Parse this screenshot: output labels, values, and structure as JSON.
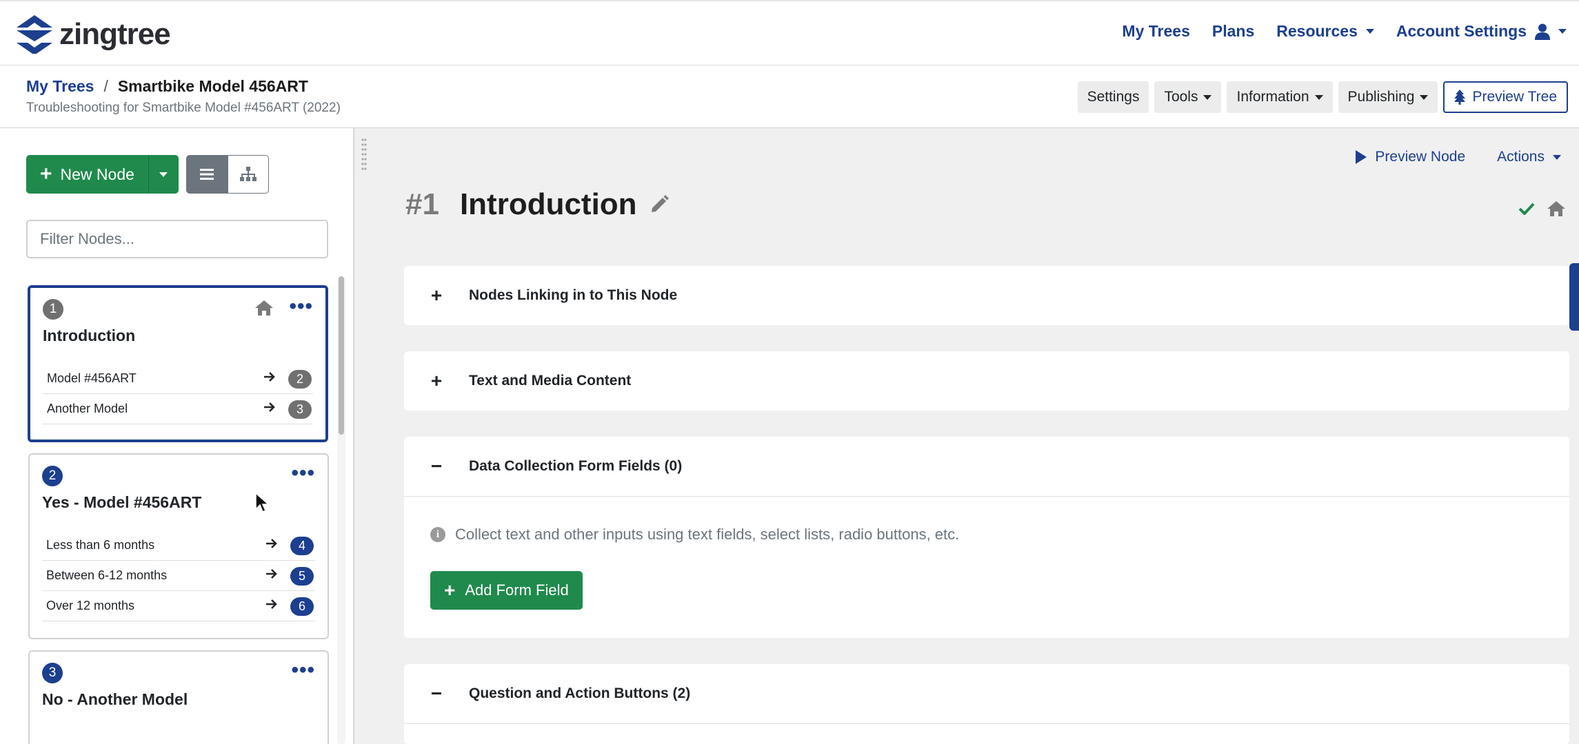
{
  "brand": {
    "name": "zingtree",
    "color_primary": "#1c3f8f",
    "color_success": "#1f8a4c"
  },
  "topnav": {
    "my_trees": "My Trees",
    "plans": "Plans",
    "resources": "Resources",
    "account_settings": "Account Settings"
  },
  "breadcrumb": {
    "root": "My Trees",
    "separator": "/",
    "current": "Smartbike Model 456ART",
    "description": "Troubleshooting for Smartbike Model #456ART (2022)"
  },
  "toolbar": {
    "settings": "Settings",
    "tools": "Tools",
    "information": "Information",
    "publishing": "Publishing",
    "preview_tree": "Preview Tree"
  },
  "sidebar": {
    "new_node": "New Node",
    "filter_placeholder": "Filter Nodes...",
    "nodes": [
      {
        "number": "1",
        "title": "Introduction",
        "is_home": true,
        "links": [
          {
            "label": "Model #456ART",
            "target": "2"
          },
          {
            "label": "Another Model",
            "target": "3"
          }
        ]
      },
      {
        "number": "2",
        "title": "Yes - Model #456ART",
        "is_home": false,
        "links": [
          {
            "label": "Less than 6 months",
            "target": "4"
          },
          {
            "label": "Between 6-12 months",
            "target": "5"
          },
          {
            "label": "Over 12 months",
            "target": "6"
          }
        ]
      },
      {
        "number": "3",
        "title": "No - Another Model",
        "is_home": false,
        "links": []
      }
    ]
  },
  "main": {
    "preview_node": "Preview Node",
    "actions": "Actions",
    "node_number": "#1",
    "node_title": "Introduction",
    "panels": [
      {
        "symbol": "+",
        "title": "Nodes Linking in to This Node"
      },
      {
        "symbol": "+",
        "title": "Text and Media Content"
      },
      {
        "symbol": "−",
        "title": "Data Collection Form Fields (0)",
        "info": "Collect text and other inputs using text fields, select lists, radio buttons, etc.",
        "button": "Add Form Field"
      },
      {
        "symbol": "−",
        "title": "Question and Action Buttons (2)"
      }
    ]
  }
}
